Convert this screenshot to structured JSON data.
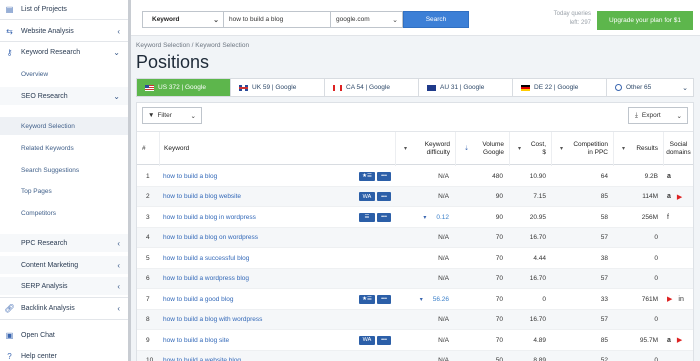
{
  "sidebar": {
    "items": [
      {
        "label": "List of Projects",
        "icon": "list-icon"
      },
      {
        "label": "Website Analysis",
        "icon": "web-icon"
      },
      {
        "label": "Keyword Research",
        "icon": "key-icon"
      },
      {
        "label": "Overview"
      },
      {
        "label": "SEO Research"
      },
      {
        "label": "Keyword Selection"
      },
      {
        "label": "Related Keywords"
      },
      {
        "label": "Search Suggestions"
      },
      {
        "label": "Top Pages"
      },
      {
        "label": "Competitors"
      },
      {
        "label": "PPC Research"
      },
      {
        "label": "Content Marketing"
      },
      {
        "label": "SERP Analysis"
      },
      {
        "label": "Backlink Analysis",
        "icon": "link-icon"
      },
      {
        "label": "Open Chat",
        "icon": "chat-icon"
      },
      {
        "label": "Help center",
        "icon": "help-icon"
      }
    ]
  },
  "topbar": {
    "search_type": "Keyword",
    "query": "how to build a blog",
    "database": "google.com",
    "search_label": "Search",
    "today_queries": "Today queries",
    "queries_left": "left: 297",
    "upgrade_label": "Upgrade your plan for $1"
  },
  "breadcrumb": "Keyword Selection / Keyword Selection",
  "page_title": "Positions",
  "tabs": [
    {
      "label": "US 372 | Google",
      "flag": "us"
    },
    {
      "label": "UK 59 | Google",
      "flag": "uk"
    },
    {
      "label": "CA 54 | Google",
      "flag": "ca"
    },
    {
      "label": "AU 31 | Google",
      "flag": "au"
    },
    {
      "label": "DE 22 | Google",
      "flag": "de"
    },
    {
      "label": "Other 65",
      "flag": "globe"
    }
  ],
  "toolbar": {
    "filter_label": "Filter",
    "export_label": "Export"
  },
  "columns": {
    "num": "#",
    "keyword": "Keyword",
    "difficulty": "Keyword difficulty",
    "volume": "Volume Google",
    "cost": "Cost, $",
    "competition": "Competition in PPC",
    "results": "Results",
    "social": "Social domains"
  },
  "rows": [
    {
      "n": "1",
      "kw": "how to build a blog",
      "badges": [
        "★☰",
        "•••"
      ],
      "diff": "N/A",
      "vol": "480",
      "cost": "10.90",
      "comp": "64",
      "res": "9.2B",
      "social": [
        "a"
      ]
    },
    {
      "n": "2",
      "kw": "how to build a blog website",
      "badges": [
        "WA",
        "•••"
      ],
      "diff": "N/A",
      "vol": "90",
      "cost": "7.15",
      "comp": "85",
      "res": "114M",
      "social": [
        "a",
        "yt"
      ]
    },
    {
      "n": "3",
      "kw": "how to build a blog in wordpress",
      "badges": [
        "☰",
        "•••"
      ],
      "diff": "0.12",
      "vol": "90",
      "cost": "20.95",
      "comp": "58",
      "res": "256M",
      "social": [
        "f"
      ]
    },
    {
      "n": "4",
      "kw": "how to build a blog on wordpress",
      "badges": [],
      "diff": "N/A",
      "vol": "70",
      "cost": "16.70",
      "comp": "57",
      "res": "0",
      "social": []
    },
    {
      "n": "5",
      "kw": "how to build a successful blog",
      "badges": [],
      "diff": "N/A",
      "vol": "70",
      "cost": "4.44",
      "comp": "38",
      "res": "0",
      "social": []
    },
    {
      "n": "6",
      "kw": "how to build a wordpress blog",
      "badges": [],
      "diff": "N/A",
      "vol": "70",
      "cost": "16.70",
      "comp": "57",
      "res": "0",
      "social": []
    },
    {
      "n": "7",
      "kw": "how to build a good blog",
      "badges": [
        "★☰",
        "•••"
      ],
      "diff": "56.26",
      "vol": "70",
      "cost": "0",
      "comp": "33",
      "res": "761M",
      "social": [
        "yt",
        "in"
      ]
    },
    {
      "n": "8",
      "kw": "how to build a blog with wordpress",
      "badges": [],
      "diff": "N/A",
      "vol": "70",
      "cost": "16.70",
      "comp": "57",
      "res": "0",
      "social": []
    },
    {
      "n": "9",
      "kw": "how to build a blog site",
      "badges": [
        "WA",
        "•••"
      ],
      "diff": "N/A",
      "vol": "70",
      "cost": "4.89",
      "comp": "85",
      "res": "95.7M",
      "social": [
        "a",
        "yt"
      ]
    },
    {
      "n": "10",
      "kw": "how to build a website blog",
      "badges": [],
      "diff": "N/A",
      "vol": "50",
      "cost": "8.89",
      "comp": "52",
      "res": "0",
      "social": []
    }
  ],
  "colors": {
    "accent": "#3c7fd6",
    "green": "#5db64c",
    "link": "#3268b8",
    "badge": "#2c5fa8"
  }
}
